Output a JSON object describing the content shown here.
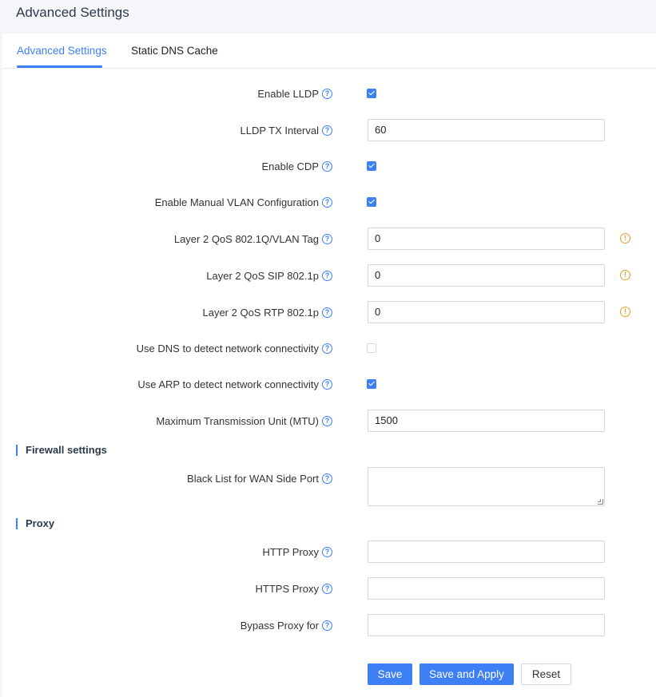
{
  "page_title": "Advanced Settings",
  "tabs": [
    {
      "label": "Advanced Settings",
      "active": true
    },
    {
      "label": "Static DNS Cache",
      "active": false
    }
  ],
  "fields": {
    "enable_lldp": {
      "label": "Enable LLDP",
      "checked": true
    },
    "lldp_tx_interval": {
      "label": "LLDP TX Interval",
      "value": "60"
    },
    "enable_cdp": {
      "label": "Enable CDP",
      "checked": true
    },
    "enable_manual_vlan": {
      "label": "Enable Manual VLAN Configuration",
      "checked": true
    },
    "l2_qos_vlan_tag": {
      "label": "Layer 2 QoS 802.1Q/VLAN Tag",
      "value": "0"
    },
    "l2_qos_sip": {
      "label": "Layer 2 QoS SIP 802.1p",
      "value": "0"
    },
    "l2_qos_rtp": {
      "label": "Layer 2 QoS RTP 802.1p",
      "value": "0"
    },
    "dns_detect": {
      "label": "Use DNS to detect network connectivity",
      "checked": false
    },
    "arp_detect": {
      "label": "Use ARP to detect network connectivity",
      "checked": true
    },
    "mtu": {
      "label": "Maximum Transmission Unit (MTU)",
      "value": "1500"
    },
    "wan_blacklist": {
      "label": "Black List for WAN Side Port",
      "value": ""
    },
    "http_proxy": {
      "label": "HTTP Proxy",
      "value": ""
    },
    "https_proxy": {
      "label": "HTTPS Proxy",
      "value": ""
    },
    "bypass_proxy": {
      "label": "Bypass Proxy for",
      "value": ""
    }
  },
  "sections": {
    "firewall": "Firewall settings",
    "proxy": "Proxy"
  },
  "buttons": {
    "save": "Save",
    "save_apply": "Save and Apply",
    "reset": "Reset"
  },
  "icons": {
    "help": "question-circle-icon",
    "warning": "exclamation-circle-icon"
  },
  "colors": {
    "accent": "#3d7ff5",
    "warning": "#e89a2e"
  }
}
